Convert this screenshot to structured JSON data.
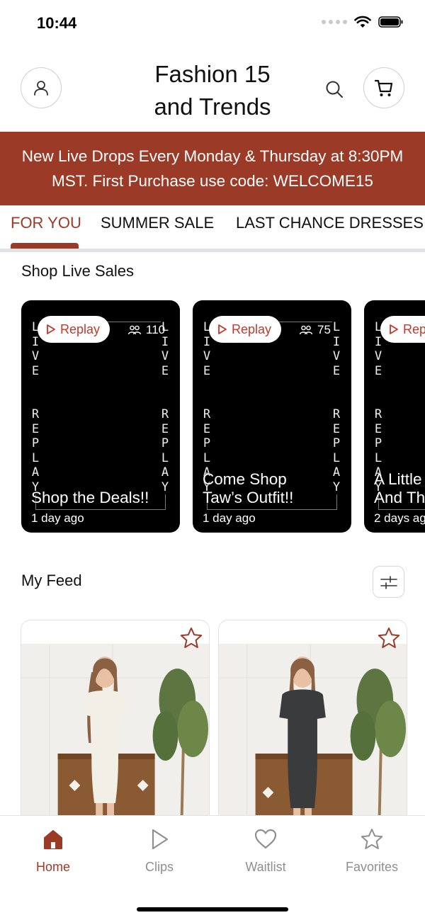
{
  "status_bar": {
    "time": "10:44"
  },
  "header": {
    "title_line1": "Fashion 15",
    "title_line2": "and Trends",
    "account_icon": "person-icon",
    "search_icon": "search-icon",
    "cart_icon": "cart-icon"
  },
  "banner": {
    "line1": "New Live Drops Every Monday & Thursday at 8:30PM",
    "line2": "MST. First Purchase use code: WELCOME15"
  },
  "tabs": [
    {
      "label": "FOR YOU",
      "active": true
    },
    {
      "label": "SUMMER SALE",
      "active": false
    },
    {
      "label": "LAST CHANCE DRESSES",
      "active": false
    }
  ],
  "live_sales": {
    "section_title": "Shop Live Sales",
    "cards": [
      {
        "badge": "Replay",
        "viewers": "110",
        "title_line1": "Shop the Deals!!",
        "title_line2": "",
        "time": "1 day ago"
      },
      {
        "badge": "Replay",
        "viewers": "75",
        "title_line1": "Come Shop",
        "title_line2": "Taw’s Outfit!!",
        "time": "1 day ago"
      },
      {
        "badge": "Replay",
        "viewers": "",
        "title_line1": "A Little",
        "title_line2": "And Th",
        "time": "2 days ag"
      }
    ],
    "frame_text_top": "LIVE",
    "frame_text_bottom": "REPLAY"
  },
  "feed": {
    "section_title": "My Feed",
    "filter_icon": "sliders-icon",
    "items": [
      {
        "favorite_icon": "star-icon",
        "dress_color": "#f2efe6"
      },
      {
        "favorite_icon": "star-icon",
        "dress_color": "#3a3b3d"
      }
    ]
  },
  "bottom_nav": [
    {
      "label": "Home",
      "icon": "home-icon",
      "active": true
    },
    {
      "label": "Clips",
      "icon": "play-icon",
      "active": false
    },
    {
      "label": "Waitlist",
      "icon": "heart-icon",
      "active": false
    },
    {
      "label": "Favorites",
      "icon": "star-icon",
      "active": false
    }
  ],
  "colors": {
    "brand": "#9b3a26",
    "replay_red": "#c0392b",
    "inactive_nav": "#8f8f8f"
  }
}
